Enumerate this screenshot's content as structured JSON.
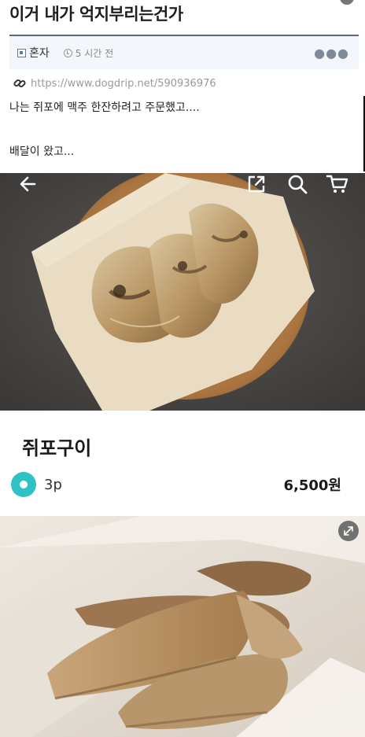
{
  "post": {
    "title": "이거 내가 억지부리는건가",
    "author": "혼자",
    "time": "5 시간 전",
    "more": "●●●",
    "url": "https://www.dogdrip.net/590936976",
    "lines": [
      "나는 쥐포에 맥주 한잔하려고 주문했고....",
      "배달이 왔고..."
    ]
  },
  "product": {
    "name": "쥐포구이",
    "rank": "3p",
    "price": "6,500원"
  },
  "icons": {
    "back": "arrow-left-icon",
    "share": "share-icon",
    "search": "search-icon",
    "cart": "cart-icon",
    "expand": "expand-icon"
  },
  "colors": {
    "accent": "#2fc2c4",
    "meta_border": "#5b6b7f"
  }
}
